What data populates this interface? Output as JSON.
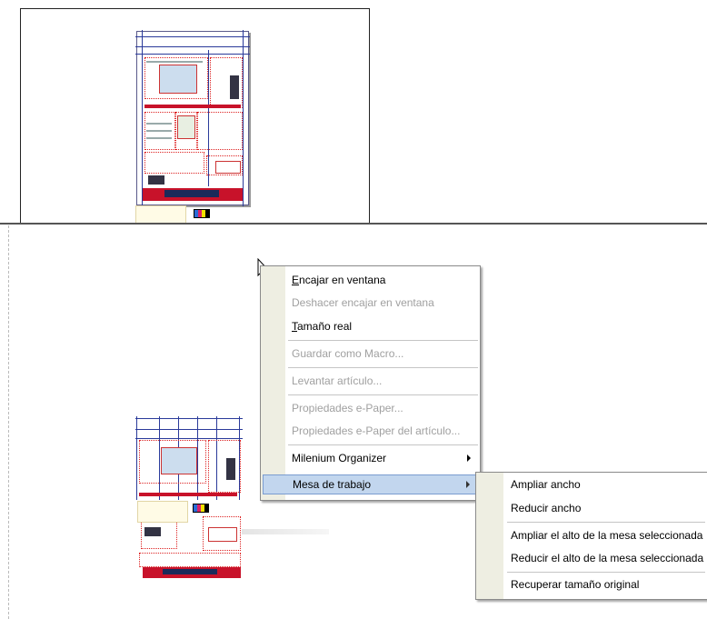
{
  "context_menu": {
    "items": [
      {
        "label_first": "E",
        "label_rest": "ncajar en ventana"
      },
      {
        "label": "Deshacer encajar en ventana"
      },
      {
        "label_first": "T",
        "label_rest": "amaño real"
      },
      {
        "label": "Guardar como Macro..."
      },
      {
        "label": "Levantar artículo..."
      },
      {
        "label": "Propiedades e-Paper..."
      },
      {
        "label": "Propiedades e-Paper del artículo..."
      },
      {
        "label": "Milenium Organizer"
      },
      {
        "label": "Mesa de trabajo"
      }
    ]
  },
  "submenu": {
    "items": [
      {
        "label": "Ampliar ancho"
      },
      {
        "label": "Reducir ancho"
      },
      {
        "label": "Ampliar el alto de la mesa seleccionada"
      },
      {
        "label": "Reducir el alto de la mesa seleccionada"
      },
      {
        "label": "Recuperar tamaño original"
      }
    ]
  },
  "colors": {
    "menu_highlight": "#c2d6ee",
    "menu_strip": "#eeeee2",
    "disabled_text": "#a0a0a0",
    "frame_red": "#dd2222",
    "guide_blue": "#2a3a9a"
  }
}
